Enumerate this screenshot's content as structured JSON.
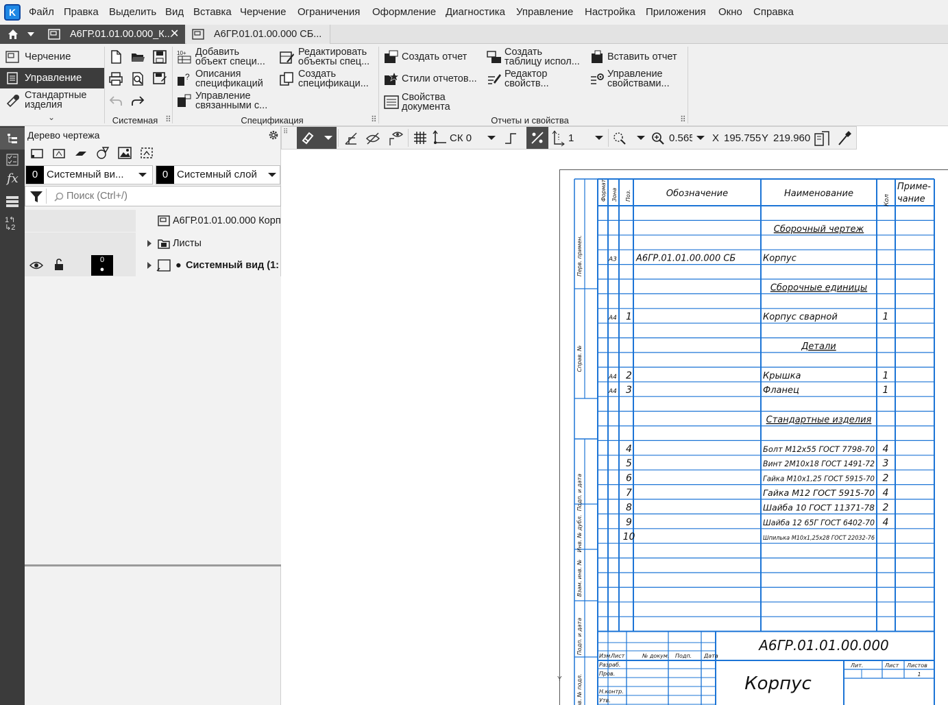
{
  "menu": [
    "Файл",
    "Правка",
    "Выделить",
    "Вид",
    "Вставка",
    "Черчение",
    "Ограничения",
    "Оформление",
    "Диагностика",
    "Управление",
    "Настройка",
    "Приложения",
    "Окно",
    "Справка"
  ],
  "tabs": [
    {
      "label": "А6ГР.01.01.00.000_К...",
      "active": true
    },
    {
      "label": "А6ГР.01.01.00.000 СБ...",
      "active": false
    }
  ],
  "ribbon": {
    "modes": [
      "Черчение",
      "Управление",
      "Стандартные изделия"
    ],
    "groups": {
      "system": "Системная",
      "spec": "Спецификация",
      "reports": "Отчеты и свойства"
    },
    "spec_buttons": {
      "add_object": [
        "Добавить",
        "объект специ..."
      ],
      "spec_descriptions": [
        "Описания",
        "спецификаций"
      ],
      "manage_linked": [
        "Управление",
        "связанными с..."
      ],
      "edit_objects": [
        "Редактировать",
        "объекты спец..."
      ],
      "create_spec": [
        "Создать",
        "спецификаци..."
      ]
    },
    "report_buttons": {
      "create_report": "Создать отчет",
      "report_styles": "Стили отчетов...",
      "doc_properties": [
        "Свойства",
        "документа"
      ],
      "create_usage_table": [
        "Создать",
        "таблицу испол..."
      ],
      "property_editor": [
        "Редактор",
        "свойств..."
      ],
      "insert_report": "Вставить отчет",
      "manage_properties": [
        "Управление",
        "свойствами..."
      ]
    }
  },
  "tree": {
    "title": "Дерево чертежа",
    "view_combo": {
      "num": "0",
      "label": "Системный ви..."
    },
    "layer_combo": {
      "num": "0",
      "label": "Системный слой"
    },
    "search_placeholder": "Поиск (Ctrl+/)",
    "root": "А6ГР.01.01.00.000 Корп",
    "sheets": "Листы",
    "system_view": "Системный вид (1:",
    "layer_badge": "0"
  },
  "drawbar": {
    "cs": "СК 0",
    "step": "1",
    "zoom": "0.565",
    "x_label": "X",
    "x_value": "195.755",
    "y_label": "Y",
    "y_value": "219.960"
  },
  "spec": {
    "headers": {
      "format": "Формат",
      "zone": "Зона",
      "pos": "Поз.",
      "designation": "Обозначение",
      "name": "Наименование",
      "qty": "Кол",
      "note": [
        "Приме-",
        "чание"
      ]
    },
    "side_labels": [
      "Перв. примен.",
      "Справ. №",
      "Подп. и дата",
      "Инв. № дубл.",
      "Взам. инв. №",
      "Подп. и дата",
      "Инв. № подл."
    ],
    "rows": [
      {
        "fmt": "",
        "pos": "",
        "des": "",
        "name": "",
        "qty": "",
        "section": false
      },
      {
        "fmt": "",
        "pos": "",
        "des": "",
        "name": "Сборочный чертеж",
        "qty": "",
        "section": true
      },
      {
        "fmt": "",
        "pos": "",
        "des": "",
        "name": "",
        "qty": "",
        "section": false
      },
      {
        "fmt": "А3",
        "pos": "",
        "des": "А6ГР.01.01.00.000 СБ",
        "name": "Корпус",
        "qty": "",
        "section": false
      },
      {
        "fmt": "",
        "pos": "",
        "des": "",
        "name": "",
        "qty": "",
        "section": false
      },
      {
        "fmt": "",
        "pos": "",
        "des": "",
        "name": "Сборочные единицы",
        "qty": "",
        "section": true
      },
      {
        "fmt": "",
        "pos": "",
        "des": "",
        "name": "",
        "qty": "",
        "section": false
      },
      {
        "fmt": "А4",
        "pos": "1",
        "des": "",
        "name": "Корпус сварной",
        "qty": "1",
        "section": false
      },
      {
        "fmt": "",
        "pos": "",
        "des": "",
        "name": "",
        "qty": "",
        "section": false
      },
      {
        "fmt": "",
        "pos": "",
        "des": "",
        "name": "Детали",
        "qty": "",
        "section": true
      },
      {
        "fmt": "",
        "pos": "",
        "des": "",
        "name": "",
        "qty": "",
        "section": false
      },
      {
        "fmt": "А4",
        "pos": "2",
        "des": "",
        "name": "Крышка",
        "qty": "1",
        "section": false
      },
      {
        "fmt": "А4",
        "pos": "3",
        "des": "",
        "name": "Фланец",
        "qty": "1",
        "section": false
      },
      {
        "fmt": "",
        "pos": "",
        "des": "",
        "name": "",
        "qty": "",
        "section": false
      },
      {
        "fmt": "",
        "pos": "",
        "des": "",
        "name": "Стандартные изделия",
        "qty": "",
        "section": true
      },
      {
        "fmt": "",
        "pos": "",
        "des": "",
        "name": "",
        "qty": "",
        "section": false
      },
      {
        "fmt": "",
        "pos": "4",
        "des": "",
        "name": "Болт М12х55 ГОСТ 7798-70",
        "qty": "4",
        "section": false
      },
      {
        "fmt": "",
        "pos": "5",
        "des": "",
        "name": "Винт 2М10х18 ГОСТ 1491-72",
        "qty": "3",
        "section": false
      },
      {
        "fmt": "",
        "pos": "6",
        "des": "",
        "name": "Гайка М10х1,25 ГОСТ 5915-70",
        "qty": "2",
        "section": false
      },
      {
        "fmt": "",
        "pos": "7",
        "des": "",
        "name": "Гайка М12 ГОСТ 5915-70",
        "qty": "4",
        "section": false
      },
      {
        "fmt": "",
        "pos": "8",
        "des": "",
        "name": "Шайба 10 ГОСТ 11371-78",
        "qty": "2",
        "section": false
      },
      {
        "fmt": "",
        "pos": "9",
        "des": "",
        "name": "Шайба 12 65Г ГОСТ 6402-70",
        "qty": "4",
        "section": false
      },
      {
        "fmt": "",
        "pos": "10",
        "des": "",
        "name": "Шпилька М10х1,25х28 ГОСТ 22032-76",
        "qty": "",
        "section": false
      },
      {
        "fmt": "",
        "pos": "",
        "des": "",
        "name": "",
        "qty": "",
        "section": false
      },
      {
        "fmt": "",
        "pos": "",
        "des": "",
        "name": "",
        "qty": "",
        "section": false
      },
      {
        "fmt": "",
        "pos": "",
        "des": "",
        "name": "",
        "qty": "",
        "section": false
      },
      {
        "fmt": "",
        "pos": "",
        "des": "",
        "name": "",
        "qty": "",
        "section": false
      },
      {
        "fmt": "",
        "pos": "",
        "des": "",
        "name": "",
        "qty": "",
        "section": false
      },
      {
        "fmt": "",
        "pos": "",
        "des": "",
        "name": "",
        "qty": "",
        "section": false
      }
    ],
    "title_block": {
      "designation": "А6ГР.01.01.00.000",
      "name": "Корпус",
      "col_labels": [
        "Изм.",
        "Лист",
        "№ докум.",
        "Подп.",
        "Дата"
      ],
      "row_labels": [
        "Разраб.",
        "Пров.",
        "",
        "Н.контр.",
        "Утв."
      ],
      "lit": "Лит.",
      "sheet": "Лист",
      "sheets": "Листов",
      "sheets_value": "1"
    }
  },
  "colors": {
    "accent_blue": "#1e88e5",
    "spec_line": "#1b74d6",
    "dark_panel": "#3b3b3b"
  }
}
